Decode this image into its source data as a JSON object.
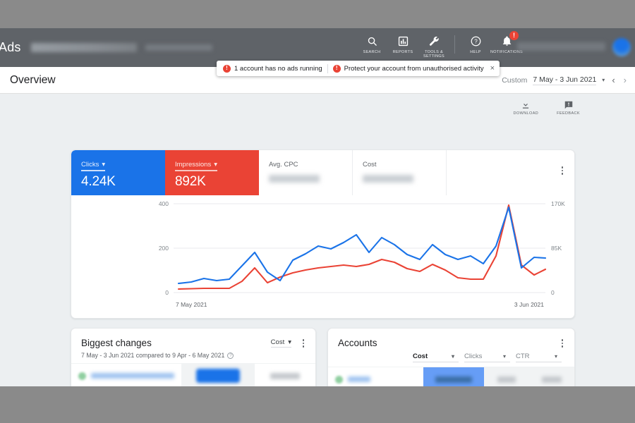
{
  "app": {
    "brand": "Ads",
    "topnav": [
      {
        "label": "SEARCH",
        "icon": "search-icon"
      },
      {
        "label": "REPORTS",
        "icon": "reports-icon"
      },
      {
        "label": "TOOLS &\nSETTINGS",
        "icon": "wrench-icon"
      },
      {
        "label": "HELP",
        "icon": "help-icon"
      },
      {
        "label": "NOTIFICATIONS",
        "icon": "bell-icon"
      }
    ],
    "notification_badge": "!"
  },
  "notices": {
    "items": [
      {
        "icon": "error-icon",
        "text": "1 account has no ads running"
      },
      {
        "icon": "error-icon",
        "text": "Protect your account from unauthorised activity"
      }
    ],
    "close_label": "×"
  },
  "header": {
    "title": "Overview",
    "date": {
      "label": "Custom",
      "value": "7 May - 3 Jun 2021",
      "caret": "▾",
      "prev": "‹",
      "next": "›"
    }
  },
  "actions": [
    {
      "label": "DOWNLOAD",
      "icon": "download-icon"
    },
    {
      "label": "FEEDBACK",
      "icon": "feedback-icon"
    }
  ],
  "metrics": [
    {
      "label": "Clicks",
      "value": "4.24K",
      "state": "selected-blue",
      "color": "#1a73e8",
      "caret": "▾"
    },
    {
      "label": "Impressions",
      "value": "892K",
      "state": "selected-red",
      "color": "#ea4335",
      "caret": "▾"
    },
    {
      "label": "Avg. CPC",
      "value": "",
      "state": "plain",
      "redacted": true
    },
    {
      "label": "Cost",
      "value": "",
      "state": "plain",
      "redacted": true
    }
  ],
  "chart_data": {
    "type": "line",
    "title": "",
    "xlabel": "",
    "ylabel": "",
    "x_tick_labels": [
      "7 May 2021",
      "3 Jun 2021"
    ],
    "left_axis": {
      "name": "Clicks",
      "ticks": [
        0,
        200,
        400
      ],
      "ylim": [
        0,
        430
      ],
      "tick_labels": [
        "0",
        "200",
        "400"
      ]
    },
    "right_axis": {
      "name": "Impressions",
      "ticks": [
        0,
        85000,
        170000
      ],
      "ylim": [
        0,
        182500
      ],
      "tick_labels": [
        "0",
        "85K",
        "170K"
      ]
    },
    "grid": true,
    "legend": "none",
    "series": [
      {
        "name": "Clicks",
        "color": "#1a73e8",
        "axis": "left",
        "values": [
          40,
          48,
          62,
          52,
          58,
          120,
          180,
          90,
          55,
          145,
          175,
          210,
          195,
          225,
          260,
          180,
          248,
          215,
          170,
          150,
          215,
          170,
          148,
          165,
          130,
          210,
          390,
          110,
          160,
          155
        ]
      },
      {
        "name": "Impressions",
        "color": "#ea4335",
        "axis": "right",
        "values": [
          7000,
          7500,
          8000,
          8000,
          8000,
          22000,
          50000,
          20000,
          30000,
          38000,
          44000,
          50000,
          52000,
          56000,
          52000,
          58000,
          68000,
          62000,
          48000,
          42000,
          58000,
          44000,
          32000,
          30000,
          30000,
          70000,
          172000,
          52000,
          35000,
          45000
        ]
      }
    ]
  },
  "panels": {
    "biggest_changes": {
      "title": "Biggest changes",
      "subtitle": "7 May - 3 Jun 2021 compared to 9 Apr - 6 May 2021",
      "help_icon": "help-circle-icon",
      "control": {
        "label": "Cost",
        "caret": "▾"
      },
      "menu_icon": "more-vert-icon",
      "rows": [
        {
          "redacted": true,
          "bar": "blue"
        },
        {
          "redacted": true,
          "bar": "yellow"
        }
      ]
    },
    "accounts": {
      "title": "Accounts",
      "menu_icon": "more-vert-icon",
      "columns": [
        {
          "label": "Cost",
          "selected": true,
          "caret": "▾"
        },
        {
          "label": "Clicks",
          "selected": false,
          "caret": "▾"
        },
        {
          "label": "CTR",
          "selected": false,
          "caret": "▾"
        }
      ],
      "rows": [
        {
          "redacted": true,
          "status": "active",
          "bar": "blue"
        },
        {
          "redacted": true,
          "status": "active",
          "bar": "blue-light"
        }
      ]
    }
  }
}
